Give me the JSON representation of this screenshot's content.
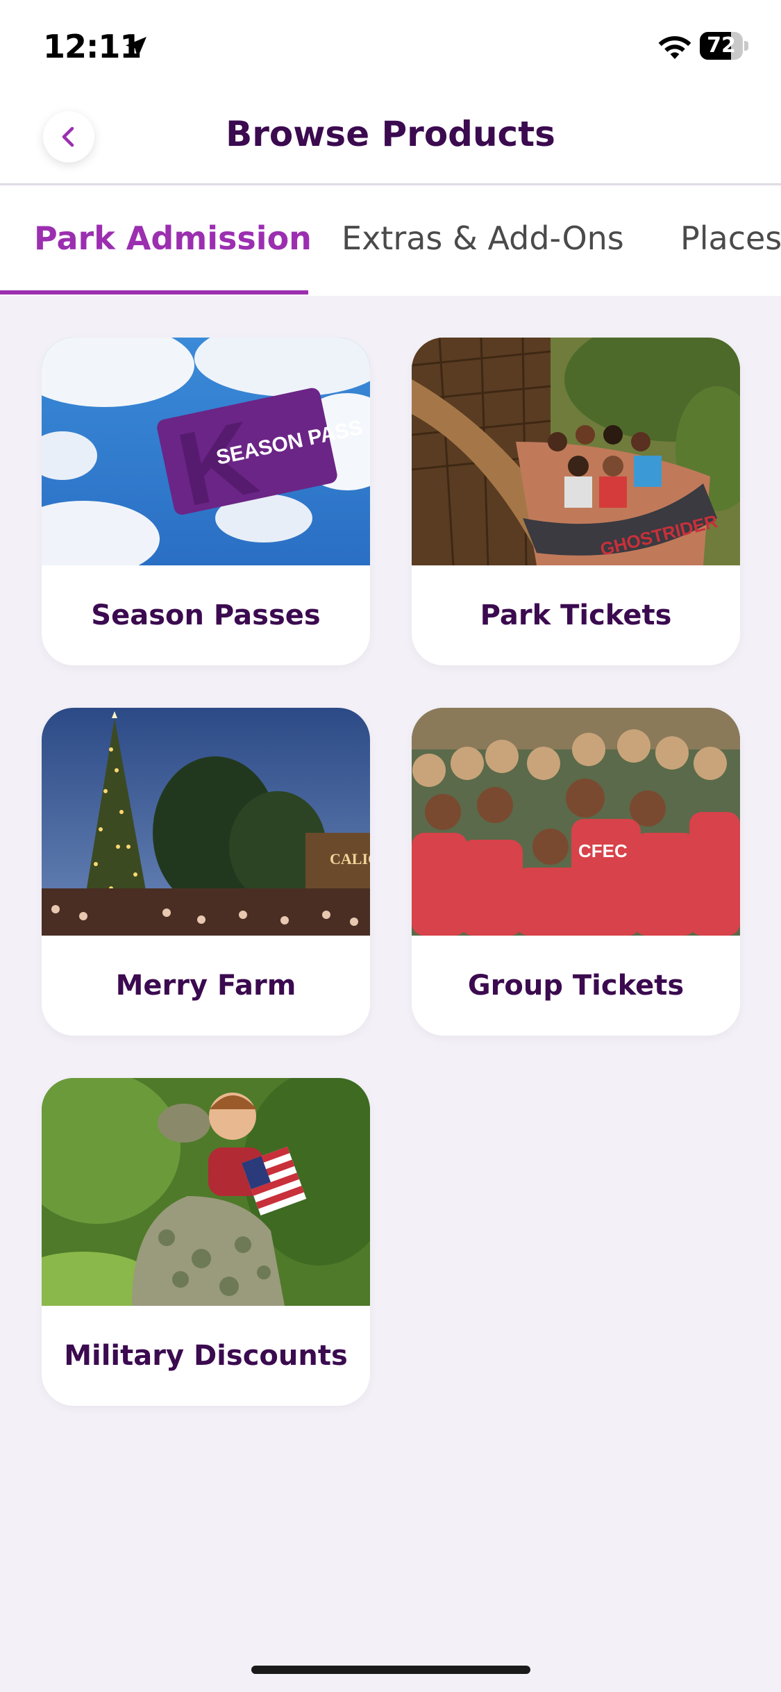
{
  "status_bar": {
    "time": "12:11",
    "battery_level": "72",
    "battery_percent": 72
  },
  "header": {
    "title": "Browse Products",
    "back_icon": "chevron-left-icon"
  },
  "tabs": [
    {
      "label": "Park Admission",
      "active": true
    },
    {
      "label": "Extras & Add-Ons",
      "active": false
    },
    {
      "label": "Places",
      "active": false
    }
  ],
  "products": [
    {
      "label": "Season Passes",
      "image": "season-pass-card-sky-image",
      "image_text": "SEASON PASS"
    },
    {
      "label": "Park Tickets",
      "image": "roller-coaster-riders-image",
      "image_text": "GHOSTRIDER"
    },
    {
      "label": "Merry Farm",
      "image": "holiday-tree-night-image",
      "image_text": "CALICO"
    },
    {
      "label": "Group Tickets",
      "image": "group-selfie-red-shirts-image",
      "image_text": "CFEC"
    },
    {
      "label": "Military Discounts",
      "image": "soldier-hugging-child-image",
      "image_text": ""
    }
  ],
  "colors": {
    "brand_purple": "#3b0a4f",
    "accent_purple": "#9b2fb0",
    "background": "#f3f1f7"
  }
}
